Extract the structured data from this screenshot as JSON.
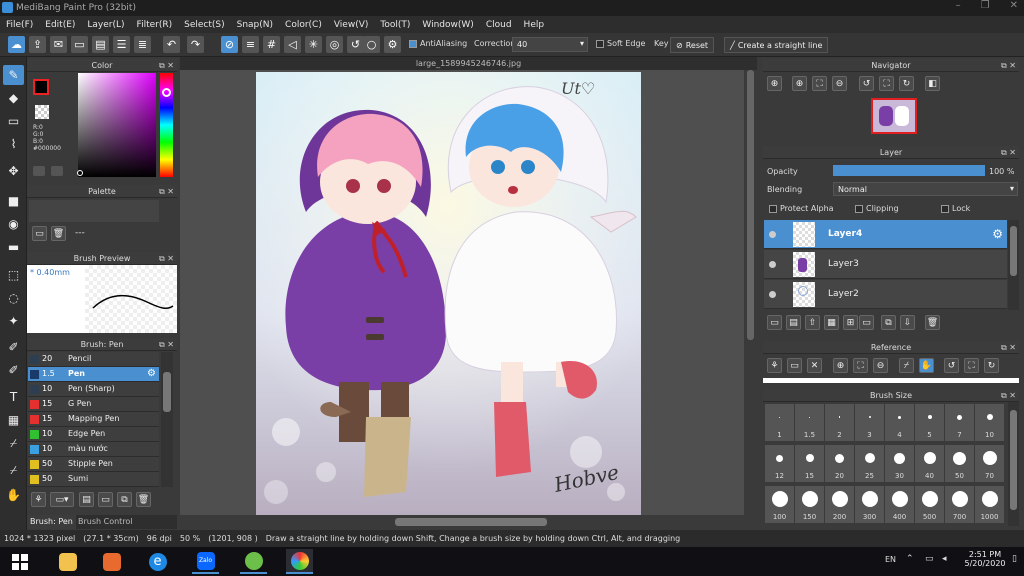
{
  "window": {
    "title": "MediBang Paint Pro (32bit)"
  },
  "menu": [
    "File(F)",
    "Edit(E)",
    "Layer(L)",
    "Filter(R)",
    "Select(S)",
    "Snap(N)",
    "Color(C)",
    "View(V)",
    "Tool(T)",
    "Window(W)",
    "Cloud",
    "Help"
  ],
  "toolbar": {
    "antialiasing_label": "AntiAliasing",
    "correction_label": "Correction",
    "correction_value": "40",
    "soft_edge_label": "Soft Edge",
    "key_label": "Key",
    "reset_label": "Reset",
    "straight_line_label": "Create a straight line"
  },
  "panels": {
    "color": {
      "title": "Color",
      "r": "R:0",
      "g": "G:0",
      "b": "B:0",
      "hex": "#000000",
      "primary": "#000000",
      "secondary": "#ffffff"
    },
    "palette": {
      "title": "Palette",
      "footer": "---"
    },
    "brush_preview": {
      "title": "Brush Preview",
      "size": "0.40mm"
    },
    "brush_list": {
      "title": "Brush: Pen",
      "items": [
        {
          "size": "20",
          "name": "Pencil",
          "color": "#2c3e50"
        },
        {
          "size": "1.5",
          "name": "Pen",
          "color": "#1a3a6a"
        },
        {
          "size": "10",
          "name": "Pen (Sharp)",
          "color": "#2c3e50"
        },
        {
          "size": "15",
          "name": "G Pen",
          "color": "#e53030"
        },
        {
          "size": "15",
          "name": "Mapping Pen",
          "color": "#e53030"
        },
        {
          "size": "10",
          "name": "Edge Pen",
          "color": "#30c030"
        },
        {
          "size": "10",
          "name": "màu nước",
          "color": "#3aa0e0"
        },
        {
          "size": "50",
          "name": "Stipple Pen",
          "color": "#e0c020"
        },
        {
          "size": "50",
          "name": "Sumi",
          "color": "#e0c020"
        }
      ],
      "tabs": [
        "Brush: Pen",
        "Brush Control"
      ]
    },
    "navigator": {
      "title": "Navigator"
    },
    "layer": {
      "title": "Layer",
      "opacity_label": "Opacity",
      "opacity_value": "100 %",
      "opacity_fraction": 1.0,
      "blending_label": "Blending",
      "blending_value": "Normal",
      "protect_alpha": "Protect Alpha",
      "clipping": "Clipping",
      "lock": "Lock",
      "layers": [
        "Layer4",
        "Layer3",
        "Layer2"
      ]
    },
    "reference": {
      "title": "Reference"
    },
    "brush_size": {
      "title": "Brush Size",
      "sizes": [
        "1",
        "1.5",
        "2",
        "3",
        "4",
        "5",
        "7",
        "10",
        "12",
        "15",
        "20",
        "25",
        "30",
        "40",
        "50",
        "70",
        "100",
        "150",
        "200",
        "300",
        "400",
        "500",
        "700",
        "1000"
      ]
    }
  },
  "document": {
    "tab": "large_1589945246746.jpg"
  },
  "status": {
    "size": "1024 * 1323 pixel",
    "physical": "(27.1 * 35cm)",
    "dpi": "96 dpi",
    "zoom": "50 %",
    "coords": "(1201, 908 )",
    "hint": "Draw a straight line by holding down Shift, Change a brush size by holding down Ctrl, Alt, and dragging"
  },
  "taskbar": {
    "lang": "EN",
    "time": "2:51 PM",
    "date": "5/20/2020",
    "zalo": "Zalo"
  },
  "artwork": {
    "signature_top": "Ut♡",
    "signature_bottom": "Hobve"
  },
  "colors": {
    "accent": "#4a90d0",
    "panel": "#3a3a3a",
    "header": "#3c3c3c"
  }
}
